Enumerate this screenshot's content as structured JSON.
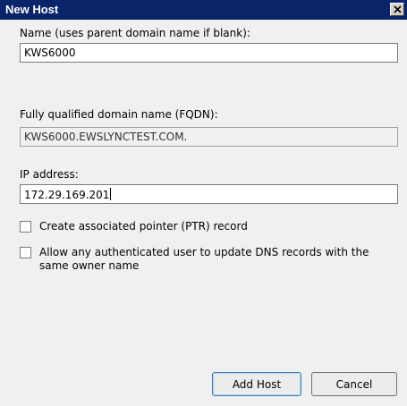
{
  "window": {
    "title": "New Host"
  },
  "form": {
    "name_label": "Name (uses parent domain name if blank):",
    "name_value": "KWS6000",
    "fqdn_label": "Fully qualified domain name (FQDN):",
    "fqdn_value": "KWS6000.EWSLYNCTEST.COM.",
    "ip_label": "IP address:",
    "ip_value": "172.29.169.201",
    "ptr_checkbox_label": "Create associated pointer (PTR) record",
    "ptr_checked": false,
    "auth_checkbox_label": "Allow any authenticated user to update DNS records with the same owner name",
    "auth_checked": false
  },
  "buttons": {
    "add_host": "Add Host",
    "cancel": "Cancel"
  },
  "icons": {
    "close": "close-icon"
  },
  "colors": {
    "titlebar": "#0a246a",
    "dialog_bg": "#f0f0f0",
    "default_button_border": "#3c7fb1"
  }
}
